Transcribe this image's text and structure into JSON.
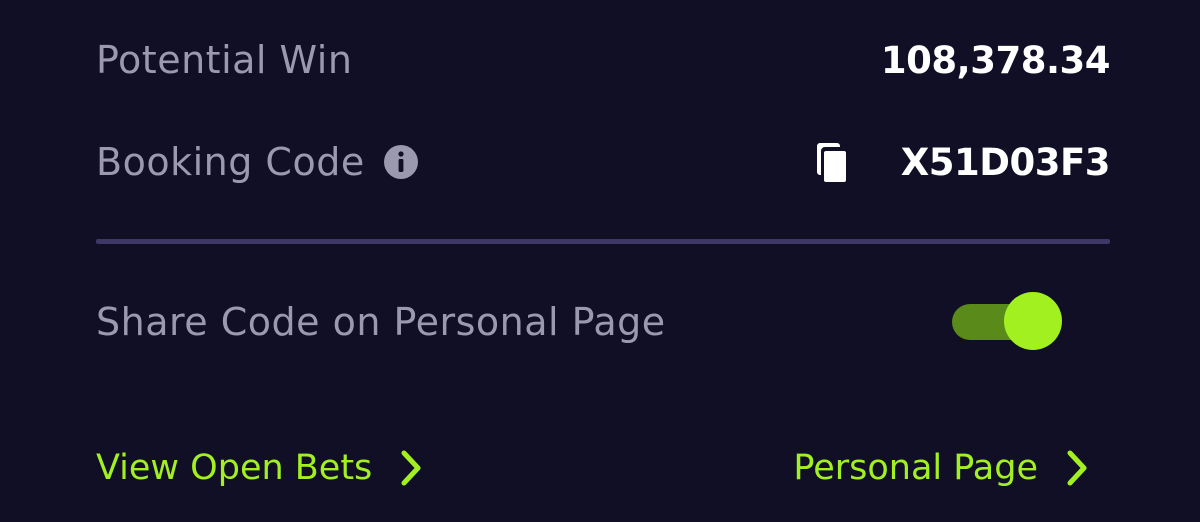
{
  "summary": {
    "potential_win_label": "Potential Win",
    "potential_win_value": "108,378.34",
    "booking_code_label": "Booking Code",
    "booking_code_value": "X51D03F3"
  },
  "share": {
    "label": "Share Code on Personal Page",
    "enabled": true
  },
  "links": {
    "view_open_bets": "View Open Bets",
    "personal_page": "Personal Page"
  },
  "icons": {
    "info": "info-icon",
    "copy": "copy-icon",
    "chevron": "chevron-right-icon"
  },
  "colors": {
    "background": "#100f26",
    "label": "#9a99ad",
    "value": "#ffffff",
    "divider": "#3d3868",
    "accent": "#a3f020",
    "toggle_track": "#5a8a1a"
  }
}
